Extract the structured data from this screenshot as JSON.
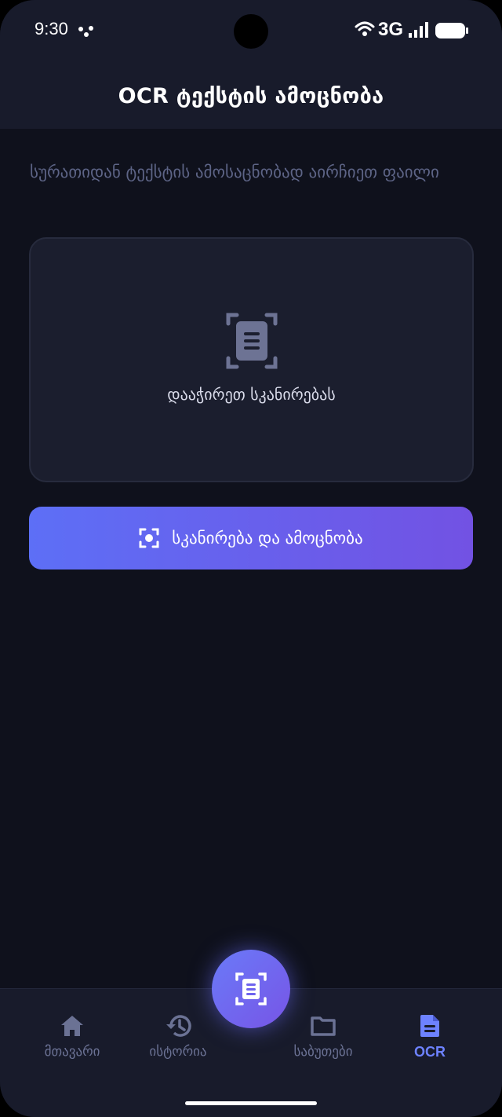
{
  "status_bar": {
    "time": "9:30",
    "network": "3G",
    "icons": [
      "dots-icon",
      "wifi-icon",
      "signal-icon",
      "battery-icon"
    ]
  },
  "header": {
    "title": "OCR ტექსტის ამოცნობა"
  },
  "main": {
    "subtitle": "სურათიდან ტექსტის ამოსაცნობად აირჩიეთ ფაილი",
    "scan_area": {
      "icon": "document-scan-icon",
      "hint": "დააჭირეთ სკანირებას"
    },
    "scan_button": {
      "icon": "scan-focus-icon",
      "label": "სკანირება და ამოცნობა"
    }
  },
  "bottom_nav": {
    "items": [
      {
        "label": "მთავარი",
        "icon": "home-icon",
        "active": false
      },
      {
        "label": "ისტორია",
        "icon": "history-icon",
        "active": false
      },
      {
        "label": "საბუთები",
        "icon": "folder-icon",
        "active": false
      },
      {
        "label": "OCR",
        "icon": "document-icon",
        "active": true
      }
    ],
    "fab_icon": "document-scan-icon"
  },
  "colors": {
    "background": "#0f111c",
    "surface": "#181b2b",
    "card": "#1b1e2e",
    "accent": "#6d82ff",
    "gradient_start": "#5d6ff6",
    "gradient_end": "#7252e3",
    "muted_text": "#5d6486"
  }
}
